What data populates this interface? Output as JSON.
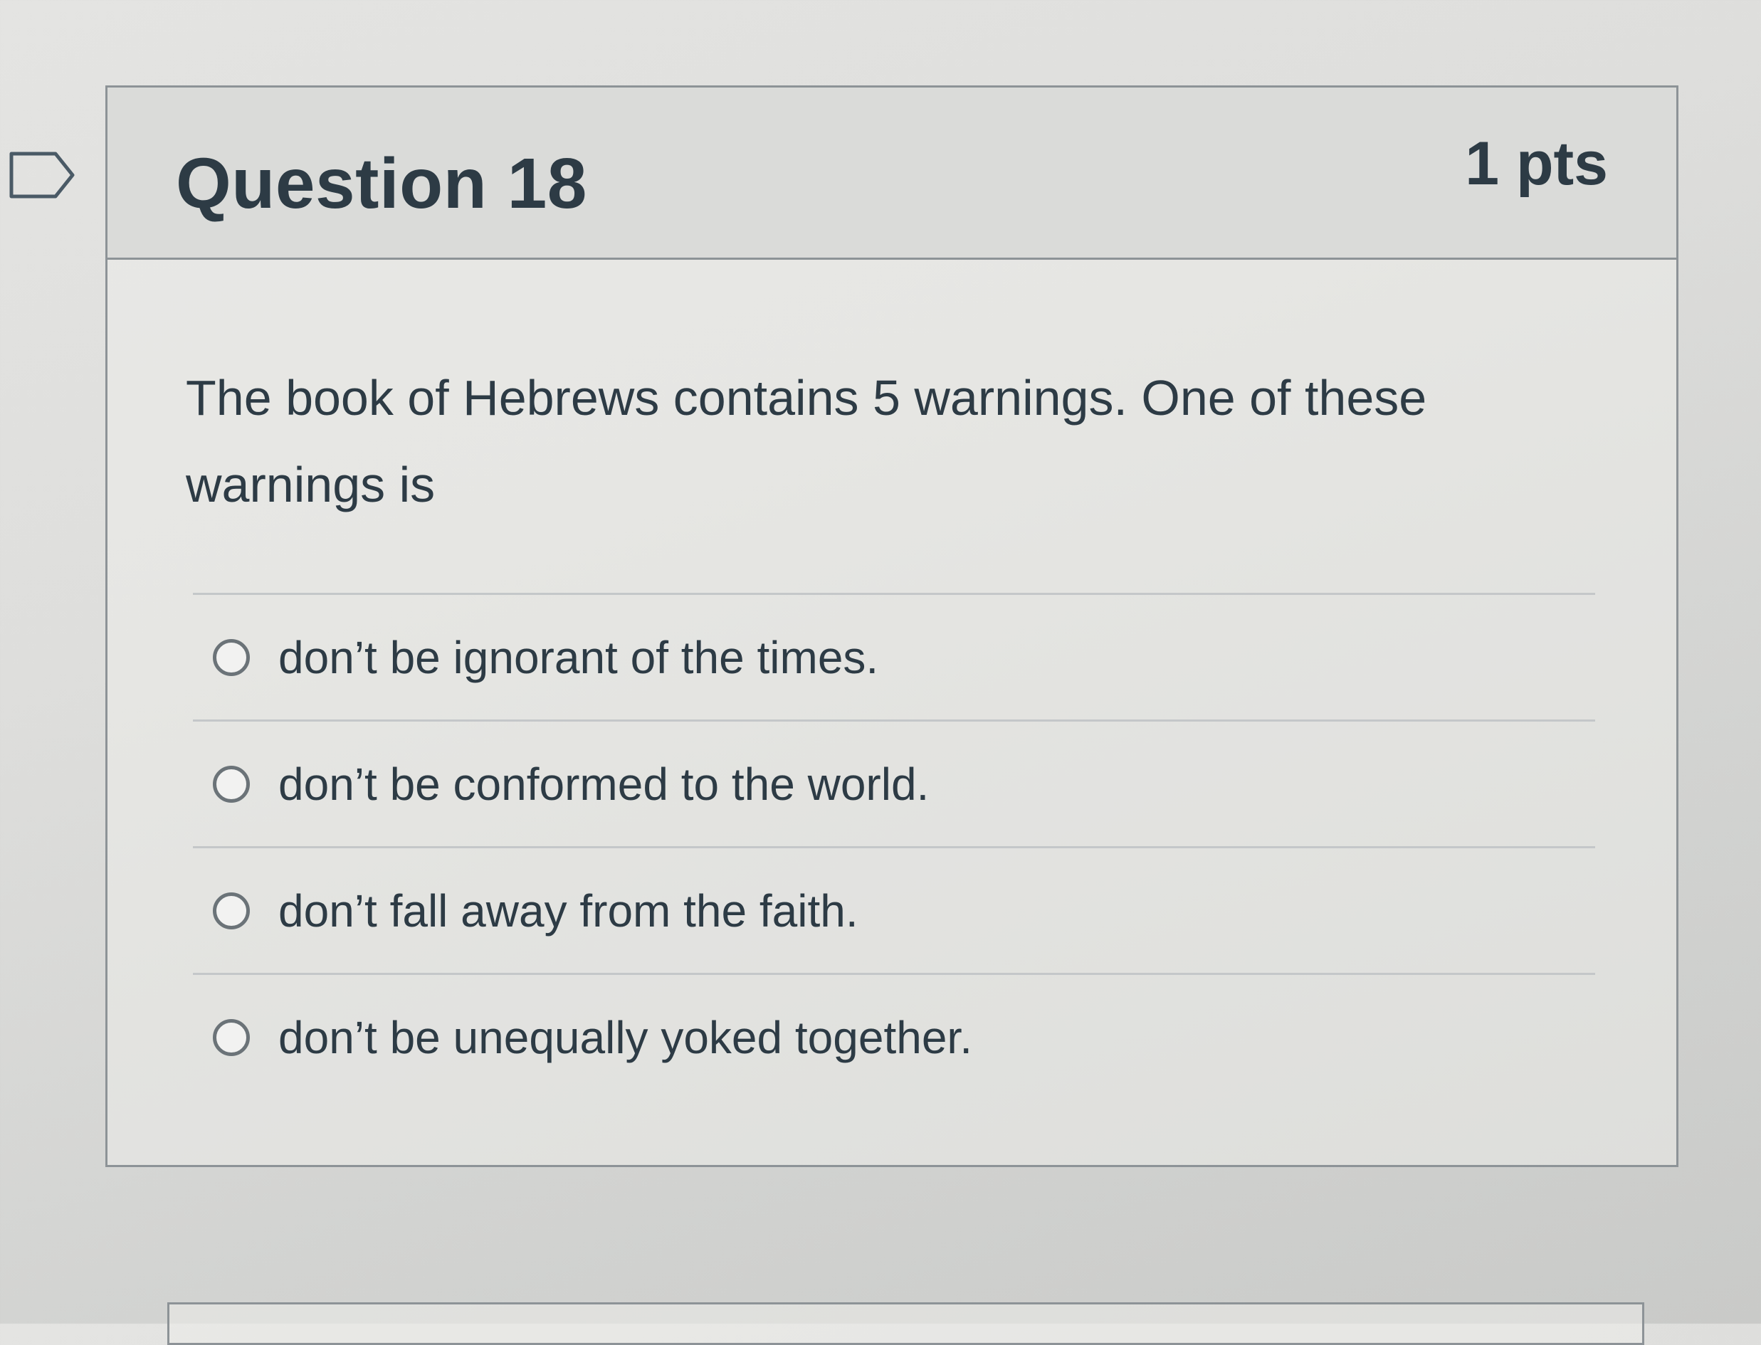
{
  "question": {
    "title": "Question 18",
    "points": "1 pts",
    "text": "The book of Hebrews contains 5 warnings. One of these warnings is",
    "flag_icon": "flag-outline-icon",
    "answers": [
      {
        "label": "don’t be ignorant of the times.",
        "selected": false
      },
      {
        "label": "don’t be conformed to the world.",
        "selected": false
      },
      {
        "label": "don’t fall away from the faith.",
        "selected": false
      },
      {
        "label": "don’t be unequally yoked together.",
        "selected": false
      }
    ]
  },
  "colors": {
    "text": "#2d3b45",
    "border": "#8d9397",
    "header_bg": "#dadbd9",
    "flag_stroke": "#4a5a66"
  }
}
